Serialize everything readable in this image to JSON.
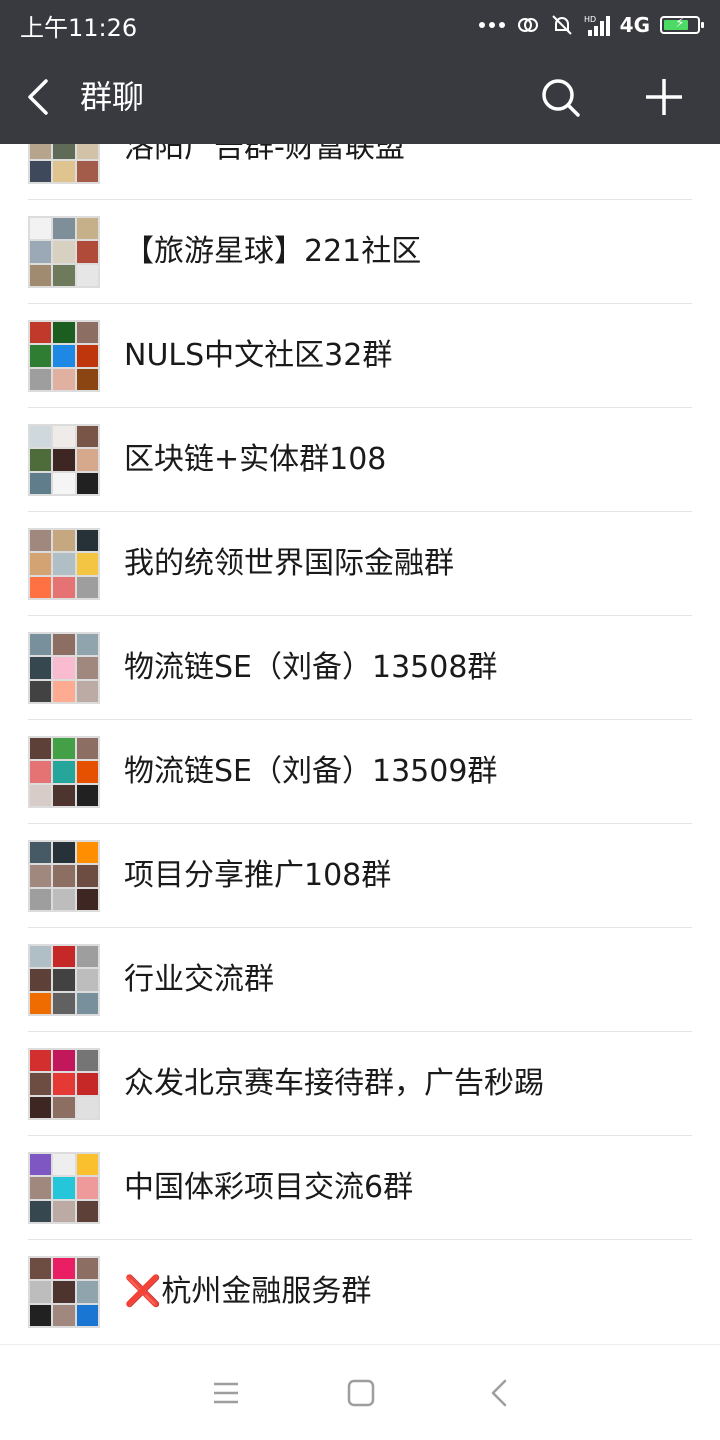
{
  "status_bar": {
    "time": "上午11:26",
    "network": "4G",
    "battery_level": 0.75,
    "icons": [
      "more-dots-icon",
      "link-icon",
      "bell-off-icon",
      "signal-icon",
      "hd-icon",
      "battery-charging-icon"
    ]
  },
  "nav": {
    "title": "群聊",
    "icons": [
      "back-arrow-icon",
      "search-icon",
      "plus-icon"
    ]
  },
  "groups": [
    {
      "name": "洛阳广告群-财富联盟",
      "tiles": [
        "#8a6f5c",
        "#c98f7a",
        "#6a7f9a",
        "#b6a48c",
        "#5f6b56",
        "#d1c2a8",
        "#3e4a5c",
        "#e0c48f",
        "#a35b4a"
      ]
    },
    {
      "name": "【旅游星球】221社区",
      "tiles": [
        "#f2f2f2",
        "#7f8f99",
        "#c6b08a",
        "#9ba8b5",
        "#d8d0c0",
        "#b04b3a",
        "#a08a70",
        "#6e7a5c",
        "#e6e6e6"
      ]
    },
    {
      "name": "NULS中文社区32群",
      "tiles": [
        "#c0392b",
        "#1b5e20",
        "#8d6e63",
        "#2e7d32",
        "#1e88e5",
        "#bf360c",
        "#9e9e9e",
        "#e0b0a0",
        "#8b4513"
      ]
    },
    {
      "name": "区块链+实体群108",
      "tiles": [
        "#cfd8dc",
        "#efebe9",
        "#795548",
        "#4e6b3a",
        "#3e2723",
        "#d7a98c",
        "#607d8b",
        "#f5f5f5",
        "#212121"
      ]
    },
    {
      "name": "我的统领世界国际金融群",
      "tiles": [
        "#a1887f",
        "#c5a880",
        "#263238",
        "#d4a373",
        "#b0bec5",
        "#f4c542",
        "#ff7043",
        "#e57373",
        "#9e9e9e"
      ]
    },
    {
      "name": "物流链SE（刘备）13508群",
      "tiles": [
        "#78909c",
        "#8d6e63",
        "#90a4ae",
        "#37474f",
        "#f8bbd0",
        "#a1887f",
        "#424242",
        "#ffab91",
        "#bcaaa4"
      ]
    },
    {
      "name": "物流链SE（刘备）13509群",
      "tiles": [
        "#5d4037",
        "#43a047",
        "#8d6e63",
        "#e57373",
        "#26a69a",
        "#e65100",
        "#d7ccc8",
        "#4e342e",
        "#212121"
      ]
    },
    {
      "name": "项目分享推广108群",
      "tiles": [
        "#455a64",
        "#263238",
        "#ff8f00",
        "#a1887f",
        "#8d6e63",
        "#6d4c41",
        "#9e9e9e",
        "#bdbdbd",
        "#3e2723"
      ]
    },
    {
      "name": "行业交流群",
      "tiles": [
        "#b0bec5",
        "#c62828",
        "#9e9e9e",
        "#5d4037",
        "#424242",
        "#bdbdbd",
        "#ef6c00",
        "#616161",
        "#78909c"
      ]
    },
    {
      "name": "众发北京赛车接待群，广告秒踢",
      "tiles": [
        "#d32f2f",
        "#c2185b",
        "#757575",
        "#6d4c41",
        "#e53935",
        "#c62828",
        "#3e2723",
        "#8d6e63",
        "#e0e0e0"
      ]
    },
    {
      "name": "中国体彩项目交流6群",
      "tiles": [
        "#7e57c2",
        "#eeeeee",
        "#fbc02d",
        "#a1887f",
        "#26c6da",
        "#ef9a9a",
        "#37474f",
        "#bcaaa4",
        "#5d4037"
      ]
    },
    {
      "name": "❌杭州金融服务群",
      "tiles": [
        "#6d4c41",
        "#e91e63",
        "#8d6e63",
        "#bdbdbd",
        "#4e342e",
        "#90a4ae",
        "#212121",
        "#a1887f",
        "#1976d2"
      ]
    }
  ],
  "system_nav": {
    "icons": [
      "menu-icon",
      "home-square-icon",
      "back-triangle-icon"
    ]
  },
  "colors": {
    "header_bg": "#393a3f",
    "divider": "#e5e5e5",
    "text": "#1a1a1a"
  }
}
